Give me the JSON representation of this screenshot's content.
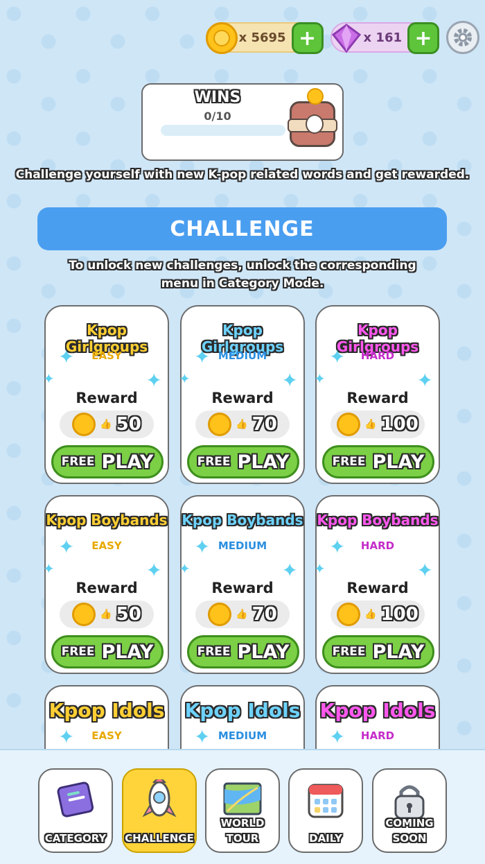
{
  "currency": {
    "coins": "x 5695",
    "gems": "x 161"
  },
  "wins": {
    "title": "WINS",
    "progress": "0/10",
    "fraction": 0
  },
  "intro_text": "Challenge yourself with new K-pop related words and get rewarded.",
  "banner": "CHALLENGE",
  "unlock_text": "To unlock new challenges, unlock the corresponding menu in Category Mode.",
  "labels": {
    "reward": "Reward",
    "free": "FREE",
    "play": "PLAY"
  },
  "cards": [
    {
      "category": "Kpop Girlgroups",
      "difficulty": "EASY",
      "reward": "50"
    },
    {
      "category": "Kpop Girlgroups",
      "difficulty": "MEDIUM",
      "reward": "70"
    },
    {
      "category": "Kpop Girlgroups",
      "difficulty": "HARD",
      "reward": "100"
    },
    {
      "category": "Kpop Boybands",
      "difficulty": "EASY",
      "reward": "50"
    },
    {
      "category": "Kpop Boybands",
      "difficulty": "MEDIUM",
      "reward": "70"
    },
    {
      "category": "Kpop Boybands",
      "difficulty": "HARD",
      "reward": "100"
    },
    {
      "category": "Kpop Idols",
      "difficulty": "EASY",
      "reward": ""
    },
    {
      "category": "Kpop Idols",
      "difficulty": "MEDIUM",
      "reward": ""
    },
    {
      "category": "Kpop Idols",
      "difficulty": "HARD",
      "reward": ""
    }
  ],
  "nav": [
    {
      "label": "CATEGORY",
      "icon": "book-icon"
    },
    {
      "label": "CHALLENGE",
      "icon": "rocket-icon"
    },
    {
      "label": "WORLD TOUR",
      "icon": "map-icon"
    },
    {
      "label": "DAILY",
      "icon": "calendar-icon"
    },
    {
      "label": "COMING SOON",
      "icon": "lock-icon"
    }
  ],
  "colors": {
    "easy": "#ffcf33",
    "medium": "#6ed3ff",
    "hard": "#ff58ee",
    "accent": "#4a9ef0",
    "play_green": "#7bd046"
  }
}
